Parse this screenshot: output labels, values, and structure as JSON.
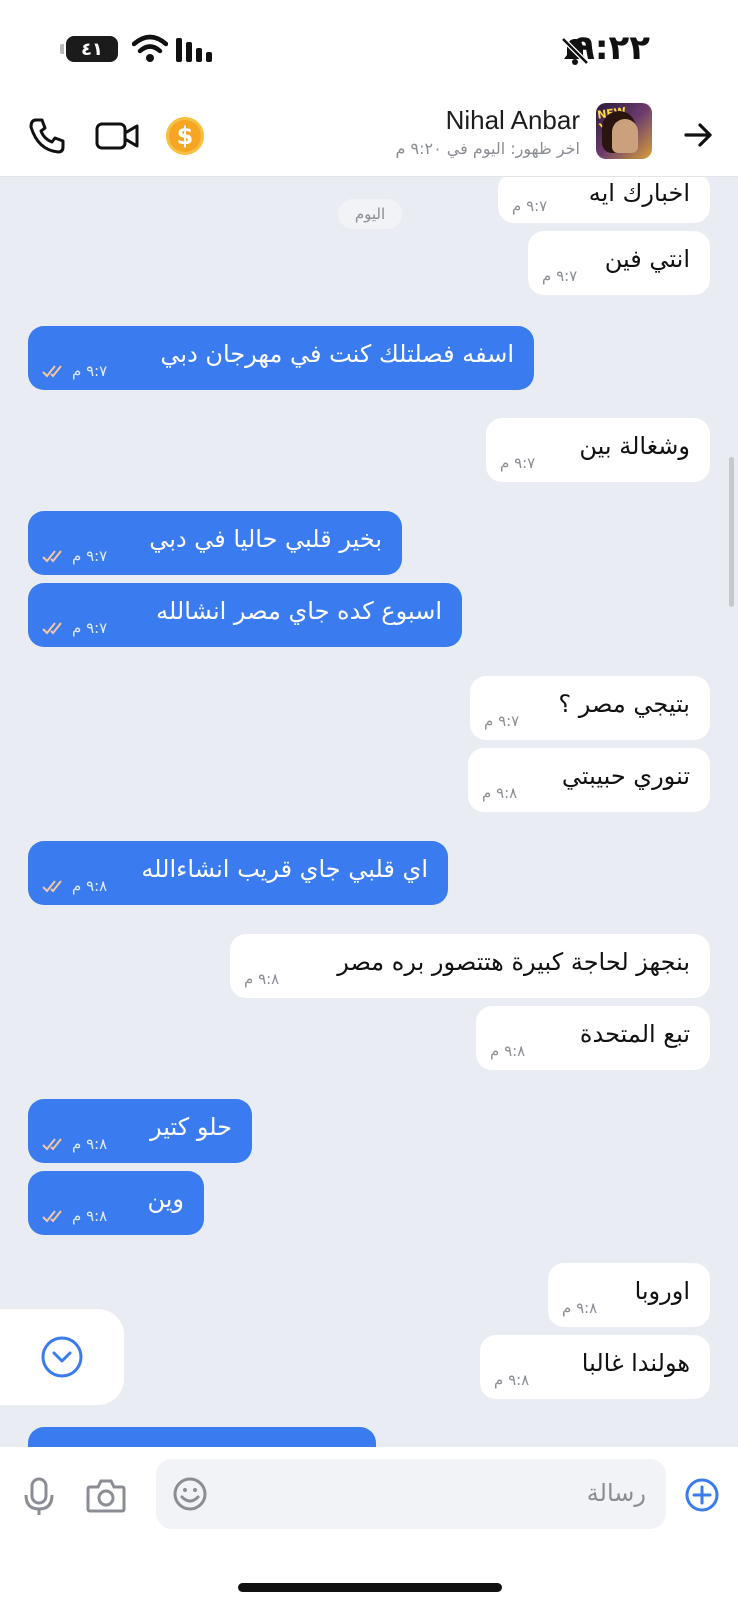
{
  "status_bar": {
    "time": "٩:٢٢",
    "battery": "٤١"
  },
  "header": {
    "contact_name": "Nihal Anbar",
    "last_seen": "اخر ظهور: اليوم في ٩:٢٠ م",
    "avatar_text": "NEW YEAR",
    "coin_symbol": "$"
  },
  "chat": {
    "date_chip": "اليوم",
    "messages": [
      {
        "dir": "in",
        "text": "اخبارك ايه",
        "time": "٩:٧ م"
      },
      {
        "dir": "in",
        "text": "انتي فين",
        "time": "٩:٧ م"
      },
      {
        "dir": "out",
        "text": "اسفه فصلتلك كنت في مهرجان دبي",
        "time": "٩:٧ م"
      },
      {
        "dir": "in",
        "text": "وشغالة بين",
        "time": "٩:٧ م"
      },
      {
        "dir": "out",
        "text": "بخير قلبي حاليا في دبي",
        "time": "٩:٧ م"
      },
      {
        "dir": "out",
        "text": "اسبوع كده جاي مصر انشالله",
        "time": "٩:٧ م"
      },
      {
        "dir": "in",
        "text": "بتيجي مصر ؟",
        "time": "٩:٧ م"
      },
      {
        "dir": "in",
        "text": "تنوري حبيبتي",
        "time": "٩:٨ م"
      },
      {
        "dir": "out",
        "text": "اي قلبي جاي قريب انشاءالله",
        "time": "٩:٨ م"
      },
      {
        "dir": "in",
        "text": "بنجهز لحاجة كبيرة هتتصور بره مصر",
        "time": "٩:٨ م"
      },
      {
        "dir": "in",
        "text": "تبع المتحدة",
        "time": "٩:٨ م"
      },
      {
        "dir": "out",
        "text": "حلو كتير",
        "time": "٩:٨ م"
      },
      {
        "dir": "out",
        "text": "وين",
        "time": "٩:٨ م"
      },
      {
        "dir": "in",
        "text": "اوروبا",
        "time": "٩:٨ م"
      },
      {
        "dir": "in",
        "text": "هولندا غالبا",
        "time": "٩:٨ م"
      }
    ]
  },
  "input": {
    "placeholder": "رسالة"
  },
  "colors": {
    "outgoing_bubble": "#3a7bf0",
    "incoming_bubble": "#ffffff",
    "chat_background": "#e9ecf3",
    "accent": "#3a7bf0",
    "read_ticks": "#f5c6a0"
  }
}
